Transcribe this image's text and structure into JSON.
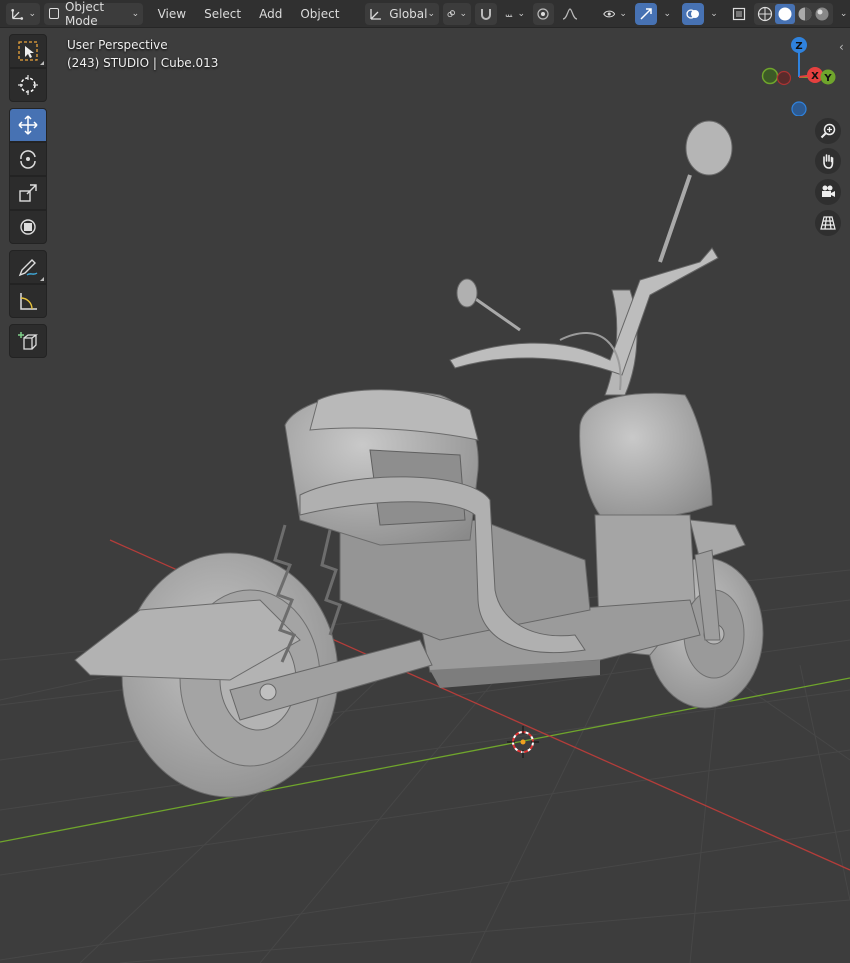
{
  "header": {
    "mode": "Object Mode",
    "menus": [
      "View",
      "Select",
      "Add",
      "Object"
    ],
    "orientation": "Global"
  },
  "viewport": {
    "view_name": "User Perspective",
    "object_info": "(243) STUDIO | Cube.013"
  },
  "gizmo": {
    "x": "X",
    "y": "Y",
    "z": "Z"
  },
  "colors": {
    "accent": "#4772b3",
    "axis_x": "#e5403f",
    "axis_y": "#6fa52c",
    "axis_z": "#2f82dd",
    "grid_background": "#3d3d3d"
  },
  "toolbar": {
    "tools": [
      "select-box-icon",
      "cursor-icon",
      "move-icon",
      "rotate-icon",
      "scale-icon",
      "transform-icon",
      "annotate-icon",
      "measure-icon",
      "add-cube-icon"
    ],
    "active_tool": "move-icon"
  }
}
